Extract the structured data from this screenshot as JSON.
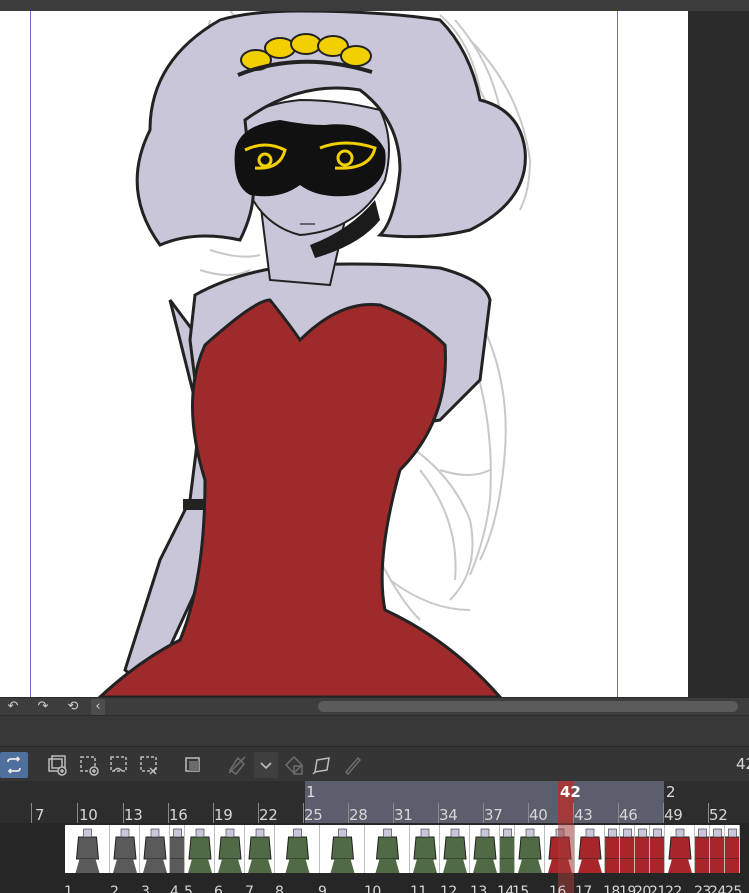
{
  "app": {
    "accent": "#4f6f9c",
    "playhead_color": "#a23a3a"
  },
  "canvas_bar": {
    "icons": [
      "undo-icon",
      "redo-icon",
      "rotate-reset-icon",
      "collapse-left-icon"
    ]
  },
  "timeline_toolbar": {
    "icons": [
      "loop-playback-icon",
      "new-animation-folder-icon",
      "new-cel-icon",
      "specify-cel-icon",
      "delete-cel-icon",
      "onion-skin-icon",
      "light-table-icon",
      "dropdown-chevron-icon",
      "delete-icon",
      "paper-icon",
      "pencil-icon"
    ],
    "frame_count": "42"
  },
  "ruler": {
    "range_start_label": "1",
    "range_end_label": "2",
    "playhead_frame": "42",
    "ticks": [
      "7",
      "10",
      "13",
      "16",
      "19",
      "22",
      "25",
      "28",
      "31",
      "34",
      "37",
      "40",
      "43",
      "46",
      "49",
      "52"
    ]
  },
  "track": {
    "frame_numbers": [
      "1",
      "2",
      "3",
      "4",
      "5",
      "6",
      "7",
      "8",
      "9",
      "10",
      "11",
      "12",
      "13",
      "14",
      "15",
      "16",
      "17",
      "18",
      "19",
      "20",
      "21",
      "22",
      "23",
      "24",
      "25"
    ]
  }
}
